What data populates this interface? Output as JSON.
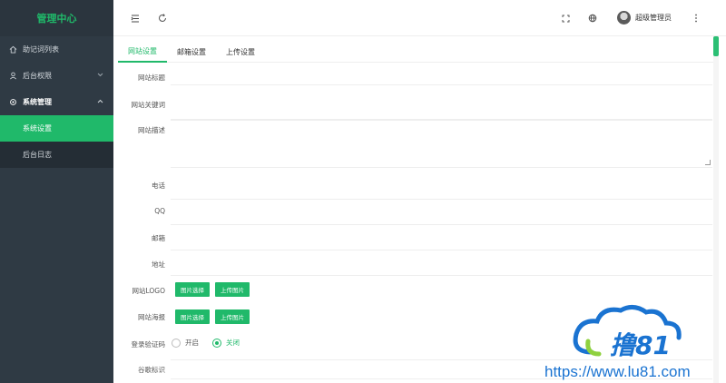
{
  "sidebar": {
    "logo": "管理中心",
    "items": [
      {
        "label": "助记词列表",
        "icon": "home-icon"
      },
      {
        "label": "后台权限",
        "icon": "user-icon",
        "chevron": "chevron-down-icon"
      },
      {
        "label": "系统管理",
        "icon": "settings-icon",
        "chevron": "chevron-up-icon"
      }
    ],
    "subitems": [
      {
        "label": "系统设置",
        "active": true
      },
      {
        "label": "后台日志",
        "active": false
      }
    ]
  },
  "topbar": {
    "icons": [
      "menu-fold-icon",
      "refresh-icon",
      "fullscreen-icon",
      "globe-icon",
      "more-icon"
    ],
    "username": "超级管理员"
  },
  "tabs": [
    {
      "label": "网站设置",
      "active": true
    },
    {
      "label": "邮箱设置",
      "active": false
    },
    {
      "label": "上传设置",
      "active": false
    }
  ],
  "form": {
    "site_title": "网站标题",
    "site_keywords": "网站关键词",
    "site_desc": "网站描述",
    "phone": "电话",
    "qq": "QQ",
    "email": "邮箱",
    "address": "地址",
    "logo": "网站LOGO",
    "poster": "网站海报",
    "login_captcha": "登录验证码",
    "stats_code": "谷歌标识",
    "btn_select": "图片选择",
    "btn_upload": "上传图片",
    "radio_on": "开启",
    "radio_off": "关闭",
    "captcha_selected": "关闭"
  },
  "watermark": {
    "brand": "撸81",
    "url": "https://www.lu81.com"
  },
  "colors": {
    "accent": "#20b96a",
    "sidebar": "#2f3a44",
    "watermark": "#1a73d1"
  }
}
